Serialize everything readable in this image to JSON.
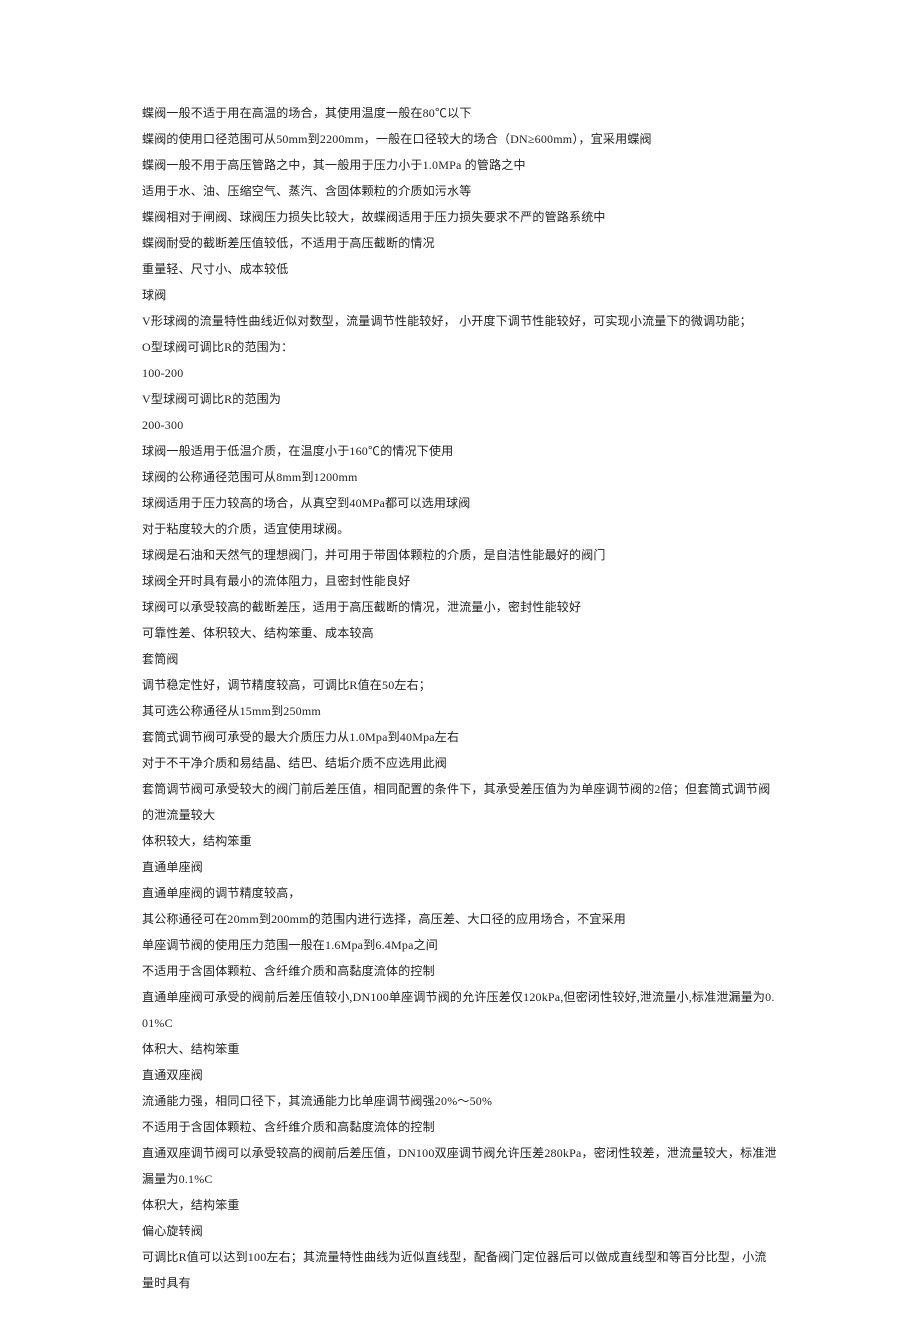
{
  "lines": [
    "蝶阀一般不适于用在高温的场合，其使用温度一般在80℃以下",
    "蝶阀的使用口径范围可从50mm到2200mm，一般在口径较大的场合（DN≥600mm），宜采用蝶阀",
    "蝶阀一般不用于高压管路之中，其一般用于压力小于1.0MPa 的管路之中",
    "适用于水、油、压缩空气、蒸汽、含固体颗粒的介质如污水等",
    "蝶阀相对于闸阀、球阀压力损失比较大，故蝶阀适用于压力损失要求不严的管路系统中",
    "蝶阀耐受的截断差压值较低，不适用于高压截断的情况",
    "重量轻、尺寸小、成本较低",
    "球阀",
    "V形球阀的流量特性曲线近似对数型，流量调节性能较好， 小开度下调节性能较好，可实现小流量下的微调功能；",
    "O型球阀可调比R的范围为：",
    "100-200",
    "V型球阀可调比R的范围为",
    "200-300",
    "球阀一般适用于低温介质，在温度小于160℃的情况下使用",
    "球阀的公称通径范围可从8mm到1200mm",
    "球阀适用于压力较高的场合，从真空到40MPa都可以选用球阀",
    "对于粘度较大的介质，适宜使用球阀。",
    "球阀是石油和天然气的理想阀门，并可用于带固体颗粒的介质，是自洁性能最好的阀门",
    "球阀全开时具有最小的流体阻力，且密封性能良好",
    "球阀可以承受较高的截断差压，适用于高压截断的情况，泄流量小，密封性能较好",
    "可靠性差、体积较大、结构笨重、成本较高",
    "套筒阀",
    "调节稳定性好，调节精度较高，可调比R值在50左右；",
    "其可选公称通径从15mm到250mm",
    "套筒式调节阀可承受的最大介质压力从1.0Mpa到40Mpa左右",
    "对于不干净介质和易结晶、结巴、结垢介质不应选用此阀",
    "套筒调节阀可承受较大的阀门前后差压值，相同配置的条件下，其承受差压值为为单座调节阀的2倍；但套筒式调节阀的泄流量较大",
    "体积较大，结构笨重",
    "直通单座阀",
    "直通单座阀的调节精度较高，",
    "其公称通径可在20mm到200mm的范围内进行选择，高压差、大口径的应用场合，不宜采用",
    "单座调节阀的使用压力范围一般在1.6Mpa到6.4Mpa之间",
    "不适用于含固体颗粒、含纤维介质和高黏度流体的控制",
    "直通单座阀可承受的阀前后差压值较小,DN100单座调节阀的允许压差仅120kPa,但密闭性较好,泄流量小,标准泄漏量为0.01%C",
    "体积大、结构笨重",
    "直通双座阀",
    "流通能力强，相同口径下，其流通能力比单座调节阀强20%～50%",
    "不适用于含固体颗粒、含纤维介质和高黏度流体的控制",
    "直通双座调节阀可以承受较高的阀前后差压值，DN100双座调节阀允许压差280kPa，密闭性较差，泄流量较大，标准泄漏量为0.1%C",
    "体积大，结构笨重",
    "偏心旋转阀",
    "可调比R值可以达到100左右；其流量特性曲线为近似直线型，配备阀门定位器后可以做成直线型和等百分比型，小流量时具有"
  ]
}
